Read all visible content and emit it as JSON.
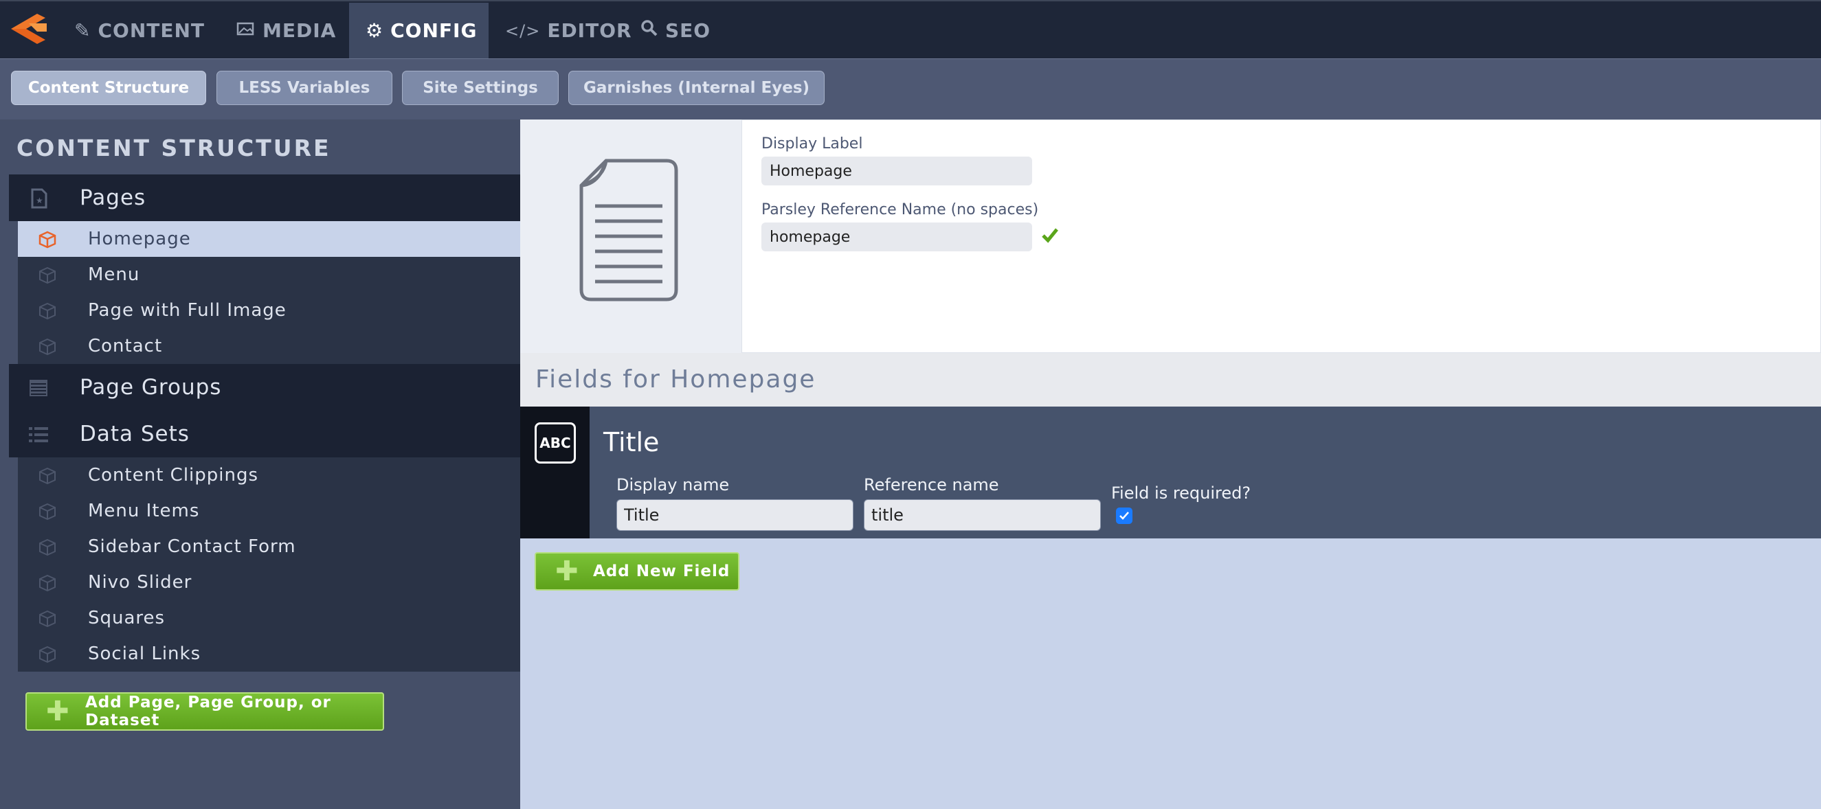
{
  "nav": {
    "tabs": [
      {
        "label": "CONTENT",
        "icon": "edit-icon"
      },
      {
        "label": "MEDIA",
        "icon": "image-icon"
      },
      {
        "label": "CONFIG",
        "icon": "gears-icon",
        "active": true
      },
      {
        "label": "EDITOR",
        "icon": "code-icon"
      },
      {
        "label": "SEO",
        "icon": "search-icon"
      }
    ]
  },
  "subnav": {
    "buttons": [
      {
        "label": "Content Structure",
        "active": true
      },
      {
        "label": "LESS Variables"
      },
      {
        "label": "Site Settings"
      },
      {
        "label": "Garnishes (Internal Eyes)"
      }
    ]
  },
  "sidebar": {
    "title": "CONTENT STRUCTURE",
    "sections": [
      {
        "label": "Pages",
        "icon": "page-icon",
        "items": [
          "Homepage",
          "Menu",
          "Page with Full Image",
          "Contact"
        ]
      },
      {
        "label": "Page Groups",
        "icon": "list-box-icon",
        "items": []
      },
      {
        "label": "Data Sets",
        "icon": "list-icon",
        "items": [
          "Content Clippings",
          "Menu Items",
          "Sidebar Contact Form",
          "Nivo Slider",
          "Squares",
          "Social Links"
        ]
      }
    ],
    "active_item": "Homepage",
    "add_button": "Add Page, Page Group, or Dataset"
  },
  "page_props": {
    "display_label_caption": "Display Label",
    "display_label_value": "Homepage",
    "ref_name_caption": "Parsley Reference Name (no spaces)",
    "ref_name_value": "homepage",
    "ref_name_valid": true
  },
  "fields": {
    "heading": "Fields for Homepage",
    "items": [
      {
        "type_badge": "ABC",
        "title": "Title",
        "display_name_caption": "Display name",
        "display_name_value": "Title",
        "ref_name_caption": "Reference name",
        "ref_name_value": "title",
        "required_caption": "Field is required?",
        "required": true
      }
    ],
    "add_button": "Add New Field"
  },
  "colors": {
    "nav_bg": "#1e2638",
    "accent_orange": "#f0782a",
    "green_button": "#6ab227",
    "checkbox_blue": "#1a7bff"
  }
}
